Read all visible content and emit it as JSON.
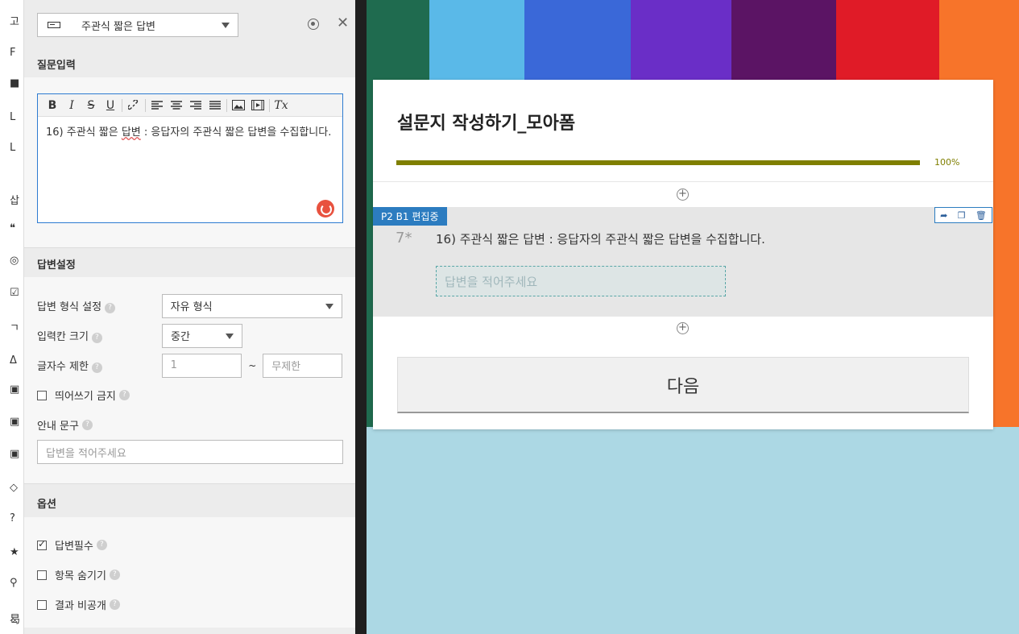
{
  "editor_panel": {
    "question_type": "주관식 짧은 답변",
    "sections": {
      "question_input": "질문입력",
      "answer_settings": "답변설정",
      "options": "옵션"
    },
    "toolbar": [
      "B",
      "I",
      "S",
      "U",
      "🔗",
      "≡",
      "≡",
      "≡",
      "≡",
      "🖼",
      "🎞",
      "Tx"
    ],
    "question_text_a": "16) 주관식 짧은 ",
    "question_text_b": "답변",
    "question_text_c": " : 응답자의 주관식 짧은 답변을 수집합니다.",
    "answer_format_label": "답변 형식 설정",
    "answer_format_value": "자유 형식",
    "input_size_label": "입력칸 크기",
    "input_size_value": "중간",
    "char_limit_label": "글자수 제한",
    "char_limit_min": "1",
    "char_limit_sep": "~",
    "char_limit_max_placeholder": "무제한",
    "no_spaces_label": "띄어쓰기 금지",
    "guide_label": "안내 문구",
    "guide_placeholder": "답변을 적어주세요",
    "required_label": "답변필수",
    "hide_label": "항목 숨기기",
    "private_label": "결과 비공개"
  },
  "edge_glyphs": [
    "고",
    "F",
    "■",
    "L",
    "L",
    "삽",
    "❝",
    "◎",
    "☑",
    "ㄱ",
    "Δ",
    "▣",
    "▣",
    "▣",
    "◇",
    "?",
    "★",
    "⚲",
    "曷"
  ],
  "form": {
    "title": "설문지 작성하기_모아폼",
    "progress_text": "100%",
    "progress_value": 1.0,
    "badge": "P2 B1 편집중",
    "question_number": "7*",
    "question_text": "16) 주관식 짧은 답변 : 응답자의 주관식 짧은 답변을 수집합니다.",
    "answer_placeholder": "답변을 적어주세요",
    "next_button": "다음"
  },
  "colors": {
    "accent_blue": "#2c7cc0",
    "progress": "#7f7f00",
    "spinner": "#e8523f"
  }
}
